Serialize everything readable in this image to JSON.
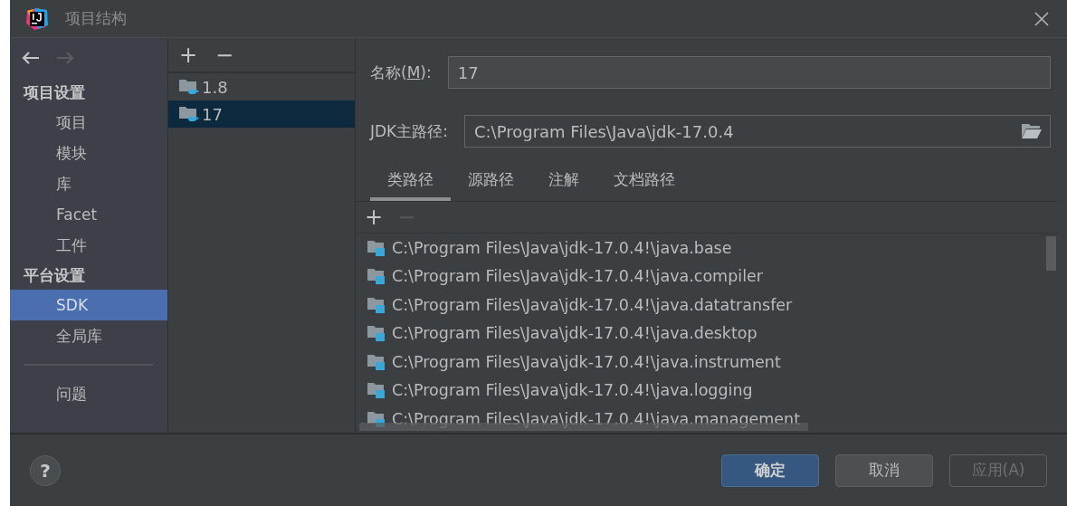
{
  "window": {
    "title": "项目结构"
  },
  "nav": {
    "back_disabled": false,
    "forward_disabled": true
  },
  "sidebar": {
    "items": [
      {
        "kind": "header",
        "label": "项目设置"
      },
      {
        "kind": "item",
        "label": "项目",
        "selected": false
      },
      {
        "kind": "item",
        "label": "模块",
        "selected": false
      },
      {
        "kind": "item",
        "label": "库",
        "selected": false
      },
      {
        "kind": "item",
        "label": "Facet",
        "selected": false
      },
      {
        "kind": "item",
        "label": "工件",
        "selected": false
      },
      {
        "kind": "header",
        "label": "平台设置"
      },
      {
        "kind": "item",
        "label": "SDK",
        "selected": true
      },
      {
        "kind": "item",
        "label": "全局库",
        "selected": false
      },
      {
        "kind": "separator"
      },
      {
        "kind": "item",
        "label": "问题",
        "selected": false
      }
    ]
  },
  "sdk_list": {
    "add": "+",
    "remove": "−",
    "items": [
      {
        "label": "1.8",
        "selected": false
      },
      {
        "label": "17",
        "selected": true
      }
    ]
  },
  "name_field": {
    "label_before": "名称(",
    "mnemonic": "M",
    "label_after": "):",
    "value": "17"
  },
  "jdk_path": {
    "label": "JDK主路径:",
    "value": "C:\\Program Files\\Java\\jdk-17.0.4"
  },
  "tabs": [
    {
      "label": "类路径",
      "selected": true
    },
    {
      "label": "源路径",
      "selected": false
    },
    {
      "label": "注解",
      "selected": false
    },
    {
      "label": "文档路径",
      "selected": false
    }
  ],
  "classpath": {
    "add": "+",
    "remove": "−",
    "remove_disabled": true,
    "entries": [
      "C:\\Program Files\\Java\\jdk-17.0.4!\\java.base",
      "C:\\Program Files\\Java\\jdk-17.0.4!\\java.compiler",
      "C:\\Program Files\\Java\\jdk-17.0.4!\\java.datatransfer",
      "C:\\Program Files\\Java\\jdk-17.0.4!\\java.desktop",
      "C:\\Program Files\\Java\\jdk-17.0.4!\\java.instrument",
      "C:\\Program Files\\Java\\jdk-17.0.4!\\java.logging",
      "C:\\Program Files\\Java\\jdk-17.0.4!\\java.management"
    ]
  },
  "help": "?",
  "buttons": [
    {
      "label": "确定",
      "kind": "primary",
      "disabled": false
    },
    {
      "label": "取消",
      "kind": "normal",
      "disabled": false
    },
    {
      "label": "应用(A)",
      "kind": "normal",
      "disabled": true
    }
  ]
}
